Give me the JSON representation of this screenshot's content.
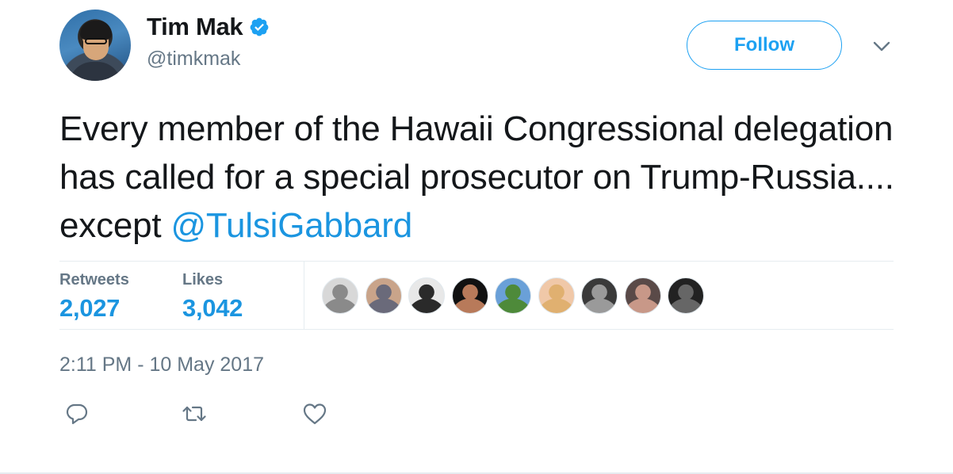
{
  "author": {
    "name": "Tim Mak",
    "handle": "@timkmak",
    "verified": true
  },
  "follow_button": {
    "label": "Follow"
  },
  "tweet": {
    "text_before_mention": "Every member of the Hawaii Congressional delegation has called for a special prosecutor on Trump-Russia.... except ",
    "mention": "@TulsiGabbard"
  },
  "stats": {
    "retweets_label": "Retweets",
    "retweets_value": "2,027",
    "likes_label": "Likes",
    "likes_value": "3,042"
  },
  "likers": [
    {
      "name": "liker-avatar-1",
      "colors": [
        "#d8d8d8",
        "#8a8a8a"
      ]
    },
    {
      "name": "liker-avatar-2",
      "colors": [
        "#c9a48a",
        "#6a6a7a"
      ]
    },
    {
      "name": "liker-avatar-3",
      "colors": [
        "#e8e8e8",
        "#2a2a2a"
      ]
    },
    {
      "name": "liker-avatar-4",
      "colors": [
        "#111111",
        "#b87a5a"
      ]
    },
    {
      "name": "liker-avatar-5",
      "colors": [
        "#6aa0d8",
        "#4e8a3a"
      ]
    },
    {
      "name": "liker-avatar-6",
      "colors": [
        "#f0c8a8",
        "#e0b070"
      ]
    },
    {
      "name": "liker-avatar-7",
      "colors": [
        "#3a3a3a",
        "#9a9a9a"
      ]
    },
    {
      "name": "liker-avatar-8",
      "colors": [
        "#5a4a48",
        "#c89888"
      ]
    },
    {
      "name": "liker-avatar-9",
      "colors": [
        "#222222",
        "#666666"
      ]
    }
  ],
  "timestamp": "2:11 PM - 10 May 2017",
  "actions": {
    "reply_icon": "reply-icon",
    "retweet_icon": "retweet-icon",
    "like_icon": "heart-icon"
  },
  "colors": {
    "accent": "#1da1f2",
    "link": "#1b95e0",
    "text": "#14171a",
    "secondary": "#657786",
    "divider": "#e6ecf0"
  }
}
